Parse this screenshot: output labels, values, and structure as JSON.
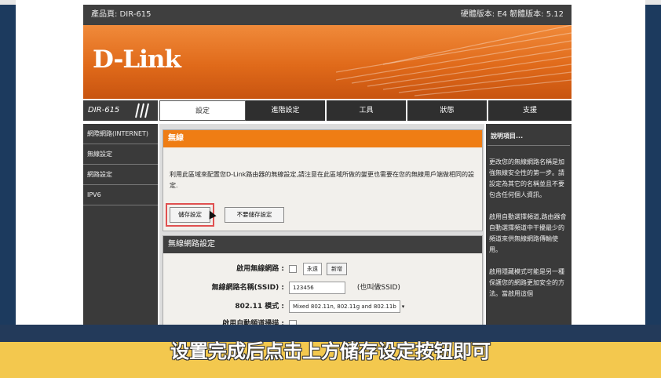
{
  "top_bar": {
    "product": "產品頁: DIR-615",
    "versions": "硬體版本: E4 韌體版本: 5.12"
  },
  "banner": {
    "logo": "D-Link"
  },
  "nav": {
    "model": "DIR-615",
    "tabs": [
      "設定",
      "進階設定",
      "工具",
      "狀態",
      "支援"
    ]
  },
  "left_menu": [
    "網際網路(INTERNET)",
    "無線設定",
    "網路設定",
    "IPV6"
  ],
  "wireless": {
    "header": "無線",
    "description": "利用此區域來配置您D-Link路由器的無線設定,請注意在此區域所做的變更也需要在您的無線用戶端做相同的設定.",
    "save_button": "儲存設定",
    "nosave_button": "不要儲存設定"
  },
  "network": {
    "header": "無線網路設定",
    "rows": [
      {
        "label": "啟用無線網路 :",
        "select": "永遠",
        "button": "新增"
      },
      {
        "label": "無線網路名稱(SSID) :",
        "value": "123456",
        "hint": "(也叫做SSID)"
      },
      {
        "label": "802.11 模式 :",
        "select": "Mixed 802.11n, 802.11g and 802.11b"
      },
      {
        "label": "啟用自動頻道掃描 :"
      }
    ]
  },
  "help": {
    "title": "說明項目...",
    "p1": "更改您的無線網路名稱是加強無線安全性的第一步。請設定為其它的名稱並且不要包含任何個人資訊。",
    "p2": "啟用自動選擇頻道,路由器會自動選擇頻道中干擾最少的頻道來供無線網路傳輸使用。",
    "p3": "啟用隱藏模式可能是另一種保護您的網路更加安全的方法。當啟用這個"
  },
  "subtitle": "设置完成后点击上方储存设定按钮即可"
}
